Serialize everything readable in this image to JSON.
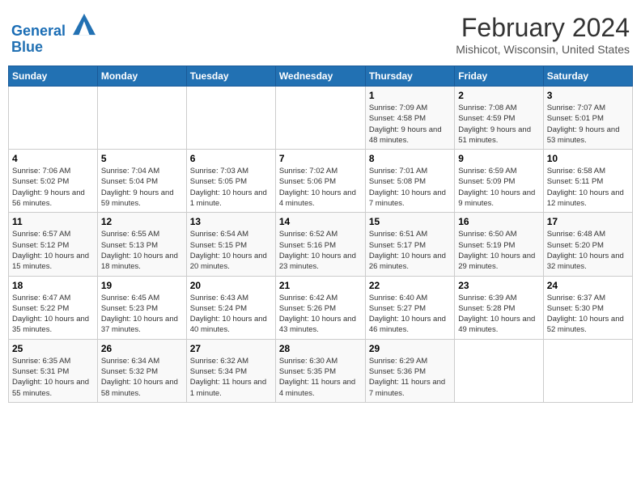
{
  "header": {
    "logo_line1": "General",
    "logo_line2": "Blue",
    "title": "February 2024",
    "subtitle": "Mishicot, Wisconsin, United States"
  },
  "weekdays": [
    "Sunday",
    "Monday",
    "Tuesday",
    "Wednesday",
    "Thursday",
    "Friday",
    "Saturday"
  ],
  "weeks": [
    [
      {
        "num": "",
        "info": ""
      },
      {
        "num": "",
        "info": ""
      },
      {
        "num": "",
        "info": ""
      },
      {
        "num": "",
        "info": ""
      },
      {
        "num": "1",
        "info": "Sunrise: 7:09 AM\nSunset: 4:58 PM\nDaylight: 9 hours and 48 minutes."
      },
      {
        "num": "2",
        "info": "Sunrise: 7:08 AM\nSunset: 4:59 PM\nDaylight: 9 hours and 51 minutes."
      },
      {
        "num": "3",
        "info": "Sunrise: 7:07 AM\nSunset: 5:01 PM\nDaylight: 9 hours and 53 minutes."
      }
    ],
    [
      {
        "num": "4",
        "info": "Sunrise: 7:06 AM\nSunset: 5:02 PM\nDaylight: 9 hours and 56 minutes."
      },
      {
        "num": "5",
        "info": "Sunrise: 7:04 AM\nSunset: 5:04 PM\nDaylight: 9 hours and 59 minutes."
      },
      {
        "num": "6",
        "info": "Sunrise: 7:03 AM\nSunset: 5:05 PM\nDaylight: 10 hours and 1 minute."
      },
      {
        "num": "7",
        "info": "Sunrise: 7:02 AM\nSunset: 5:06 PM\nDaylight: 10 hours and 4 minutes."
      },
      {
        "num": "8",
        "info": "Sunrise: 7:01 AM\nSunset: 5:08 PM\nDaylight: 10 hours and 7 minutes."
      },
      {
        "num": "9",
        "info": "Sunrise: 6:59 AM\nSunset: 5:09 PM\nDaylight: 10 hours and 9 minutes."
      },
      {
        "num": "10",
        "info": "Sunrise: 6:58 AM\nSunset: 5:11 PM\nDaylight: 10 hours and 12 minutes."
      }
    ],
    [
      {
        "num": "11",
        "info": "Sunrise: 6:57 AM\nSunset: 5:12 PM\nDaylight: 10 hours and 15 minutes."
      },
      {
        "num": "12",
        "info": "Sunrise: 6:55 AM\nSunset: 5:13 PM\nDaylight: 10 hours and 18 minutes."
      },
      {
        "num": "13",
        "info": "Sunrise: 6:54 AM\nSunset: 5:15 PM\nDaylight: 10 hours and 20 minutes."
      },
      {
        "num": "14",
        "info": "Sunrise: 6:52 AM\nSunset: 5:16 PM\nDaylight: 10 hours and 23 minutes."
      },
      {
        "num": "15",
        "info": "Sunrise: 6:51 AM\nSunset: 5:17 PM\nDaylight: 10 hours and 26 minutes."
      },
      {
        "num": "16",
        "info": "Sunrise: 6:50 AM\nSunset: 5:19 PM\nDaylight: 10 hours and 29 minutes."
      },
      {
        "num": "17",
        "info": "Sunrise: 6:48 AM\nSunset: 5:20 PM\nDaylight: 10 hours and 32 minutes."
      }
    ],
    [
      {
        "num": "18",
        "info": "Sunrise: 6:47 AM\nSunset: 5:22 PM\nDaylight: 10 hours and 35 minutes."
      },
      {
        "num": "19",
        "info": "Sunrise: 6:45 AM\nSunset: 5:23 PM\nDaylight: 10 hours and 37 minutes."
      },
      {
        "num": "20",
        "info": "Sunrise: 6:43 AM\nSunset: 5:24 PM\nDaylight: 10 hours and 40 minutes."
      },
      {
        "num": "21",
        "info": "Sunrise: 6:42 AM\nSunset: 5:26 PM\nDaylight: 10 hours and 43 minutes."
      },
      {
        "num": "22",
        "info": "Sunrise: 6:40 AM\nSunset: 5:27 PM\nDaylight: 10 hours and 46 minutes."
      },
      {
        "num": "23",
        "info": "Sunrise: 6:39 AM\nSunset: 5:28 PM\nDaylight: 10 hours and 49 minutes."
      },
      {
        "num": "24",
        "info": "Sunrise: 6:37 AM\nSunset: 5:30 PM\nDaylight: 10 hours and 52 minutes."
      }
    ],
    [
      {
        "num": "25",
        "info": "Sunrise: 6:35 AM\nSunset: 5:31 PM\nDaylight: 10 hours and 55 minutes."
      },
      {
        "num": "26",
        "info": "Sunrise: 6:34 AM\nSunset: 5:32 PM\nDaylight: 10 hours and 58 minutes."
      },
      {
        "num": "27",
        "info": "Sunrise: 6:32 AM\nSunset: 5:34 PM\nDaylight: 11 hours and 1 minute."
      },
      {
        "num": "28",
        "info": "Sunrise: 6:30 AM\nSunset: 5:35 PM\nDaylight: 11 hours and 4 minutes."
      },
      {
        "num": "29",
        "info": "Sunrise: 6:29 AM\nSunset: 5:36 PM\nDaylight: 11 hours and 7 minutes."
      },
      {
        "num": "",
        "info": ""
      },
      {
        "num": "",
        "info": ""
      }
    ]
  ]
}
